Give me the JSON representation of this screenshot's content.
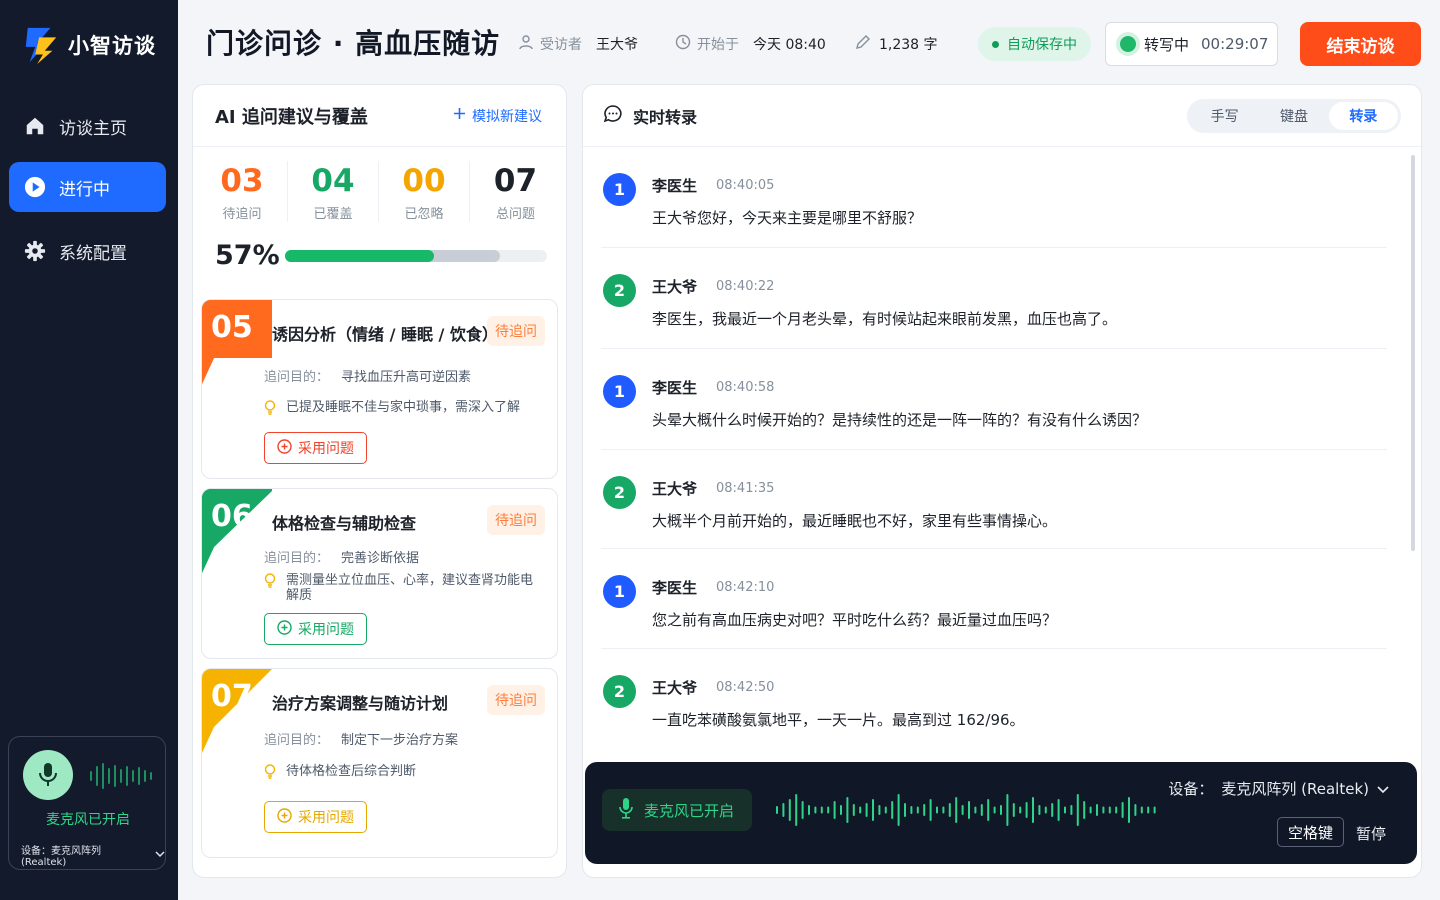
{
  "app": {
    "name": "小智访谈"
  },
  "sidebar": {
    "items": [
      {
        "label": "访谈主页",
        "icon": "home-icon"
      },
      {
        "label": "进行中",
        "icon": "play-icon",
        "active": true
      },
      {
        "label": "系统配置",
        "icon": "gear-icon"
      }
    ],
    "mic": {
      "status": "麦克风已开启",
      "device": "设备：麦克风阵列 (Realtek)"
    }
  },
  "header": {
    "title": "门诊问诊 · 高血压随访",
    "interviewee_label": "受访者",
    "interviewee": "王大爷",
    "start_label": "开始于",
    "start": "今天 08:40",
    "word_count": "1,238 字",
    "autosave": "自动保存中",
    "transcribing_label": "转写中",
    "timer": "00:29:07",
    "end_button": "结束访谈"
  },
  "suggestions": {
    "title": "AI 追问建议与覆盖",
    "action": "模拟新建议",
    "stats": [
      {
        "value": "03",
        "label": "待追问",
        "color": "#ff6a1f"
      },
      {
        "value": "04",
        "label": "已覆盖",
        "color": "#16a864"
      },
      {
        "value": "00",
        "label": "已忽略",
        "color": "#f5a500"
      },
      {
        "value": "07",
        "label": "总问题",
        "color": "#1d2129"
      }
    ],
    "progress_pct": "57%",
    "progress_covered": 0.57,
    "progress_ignored": 0.25,
    "cards": [
      {
        "num": "05",
        "title": "诱因分析（情绪 / 睡眠 / 饮食）",
        "status": "待追问",
        "purpose_label": "追问目的：",
        "purpose": "寻找血压升高可逆因素",
        "hint": "已提及睡眠不佳与家中琐事，需深入了解",
        "button": "采用问题",
        "color": "#ff6a1f",
        "btn_color": "#f0442c"
      },
      {
        "num": "06",
        "title": "体格检查与辅助检查",
        "status": "待追问",
        "purpose_label": "追问目的：",
        "purpose": "完善诊断依据",
        "hint": "需测量坐立位血压、心率，建议查肾功能电解质",
        "button": "采用问题",
        "color": "#16a864",
        "btn_color": "#16a864"
      },
      {
        "num": "07",
        "title": "治疗方案调整与随访计划",
        "status": "待追问",
        "purpose_label": "追问目的：",
        "purpose": "制定下一步治疗方案",
        "hint": "待体格检查后综合判断",
        "button": "采用问题",
        "color": "#f5b300",
        "btn_color": "#e6a800"
      }
    ]
  },
  "transcript": {
    "title": "实时转录",
    "modes": [
      "手写",
      "键盘",
      "转录"
    ],
    "active_mode": "转录",
    "messages": [
      {
        "badge": "1",
        "speaker": "李医生",
        "time": "08:40:05",
        "text": "王大爷您好，今天来主要是哪里不舒服？",
        "color": "#1f5bff"
      },
      {
        "badge": "2",
        "speaker": "王大爷",
        "time": "08:40:22",
        "text": "李医生，我最近一个月老头晕，有时候站起来眼前发黑，血压也高了。",
        "color": "#16a864"
      },
      {
        "badge": "1",
        "speaker": "李医生",
        "time": "08:40:58",
        "text": "头晕大概什么时候开始的？是持续性的还是一阵一阵的？有没有什么诱因？",
        "color": "#1f5bff"
      },
      {
        "badge": "2",
        "speaker": "王大爷",
        "time": "08:41:35",
        "text": "大概半个月前开始的，最近睡眠也不好，家里有些事情操心。",
        "color": "#16a864"
      },
      {
        "badge": "1",
        "speaker": "李医生",
        "time": "08:42:10",
        "text": "您之前有高血压病史对吧？平时吃什么药？最近量过血压吗？",
        "color": "#1f5bff"
      },
      {
        "badge": "2",
        "speaker": "王大爷",
        "time": "08:42:50",
        "text": "一直吃苯磺酸氨氯地平，一天一片。最高到过 162/96。",
        "color": "#16a864"
      }
    ],
    "dock": {
      "mic": "麦克风已开启",
      "device_label": "设备：",
      "device": "麦克风阵列 (Realtek)",
      "shortcut": "空格键",
      "pause": "暂停"
    }
  }
}
